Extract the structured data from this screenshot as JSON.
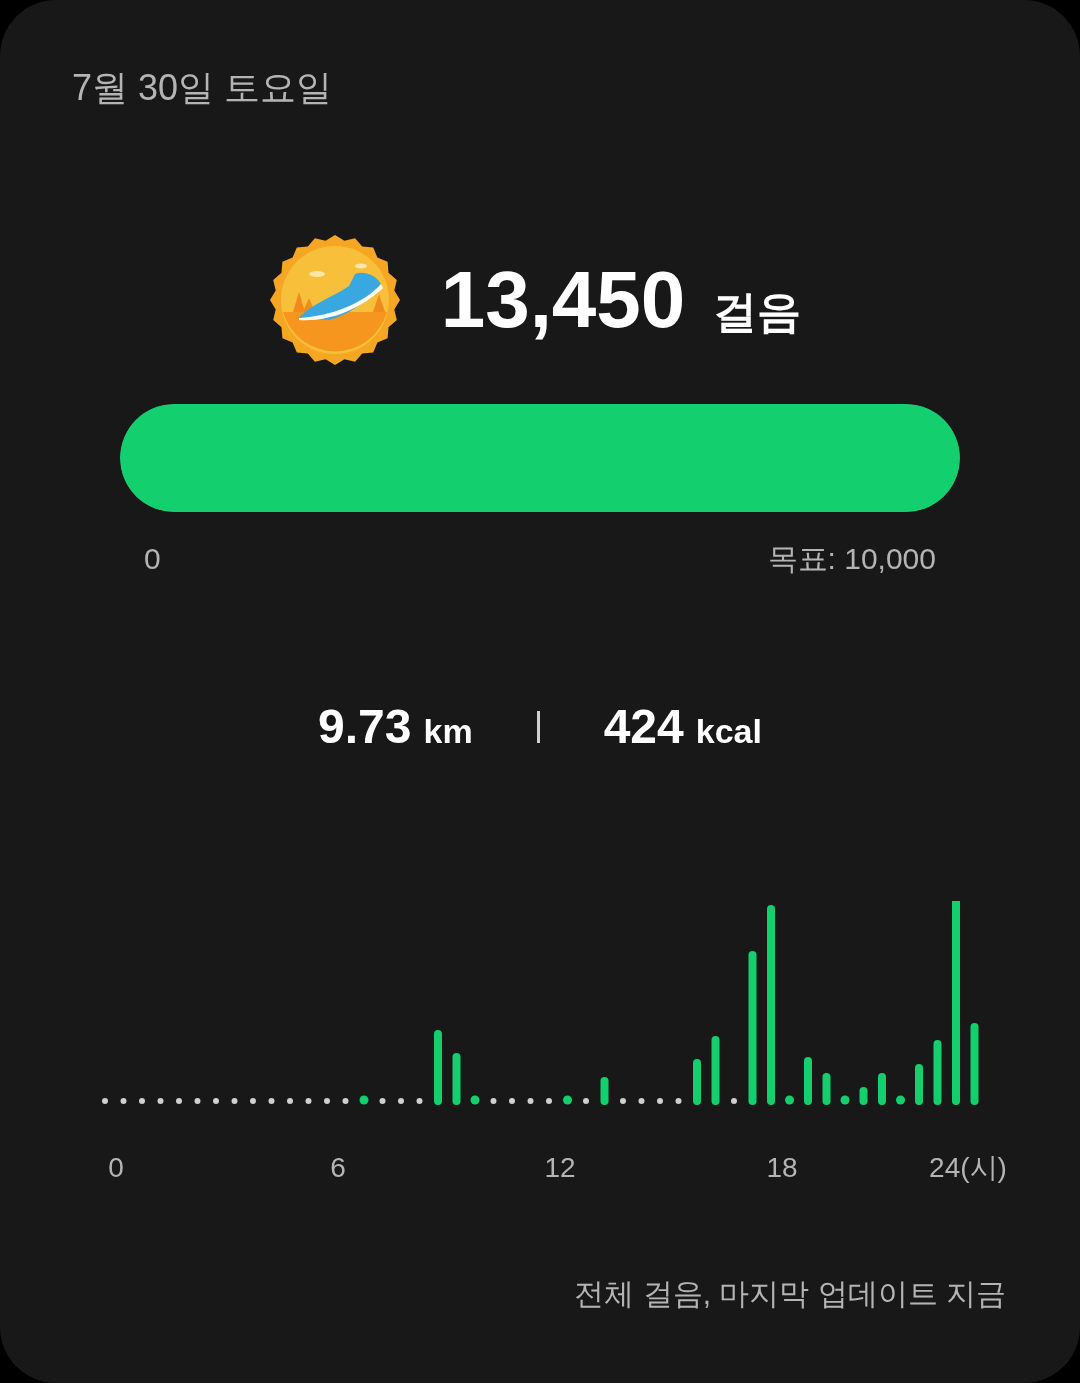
{
  "date": "7월 30일 토요일",
  "steps": {
    "count": "13,450",
    "unit": "걸음"
  },
  "progress": {
    "level": 1,
    "start_label": "0",
    "goal_label": "목표: 10,000"
  },
  "stats": [
    {
      "value": "9.73",
      "unit": "km"
    },
    {
      "value": "424",
      "unit": "kcal"
    }
  ],
  "chart": {
    "x_labels": [
      "0",
      "6",
      "12",
      "18",
      "24(시)"
    ]
  },
  "footer": "전체 걸음, 마지막 업데이트 지금"
}
